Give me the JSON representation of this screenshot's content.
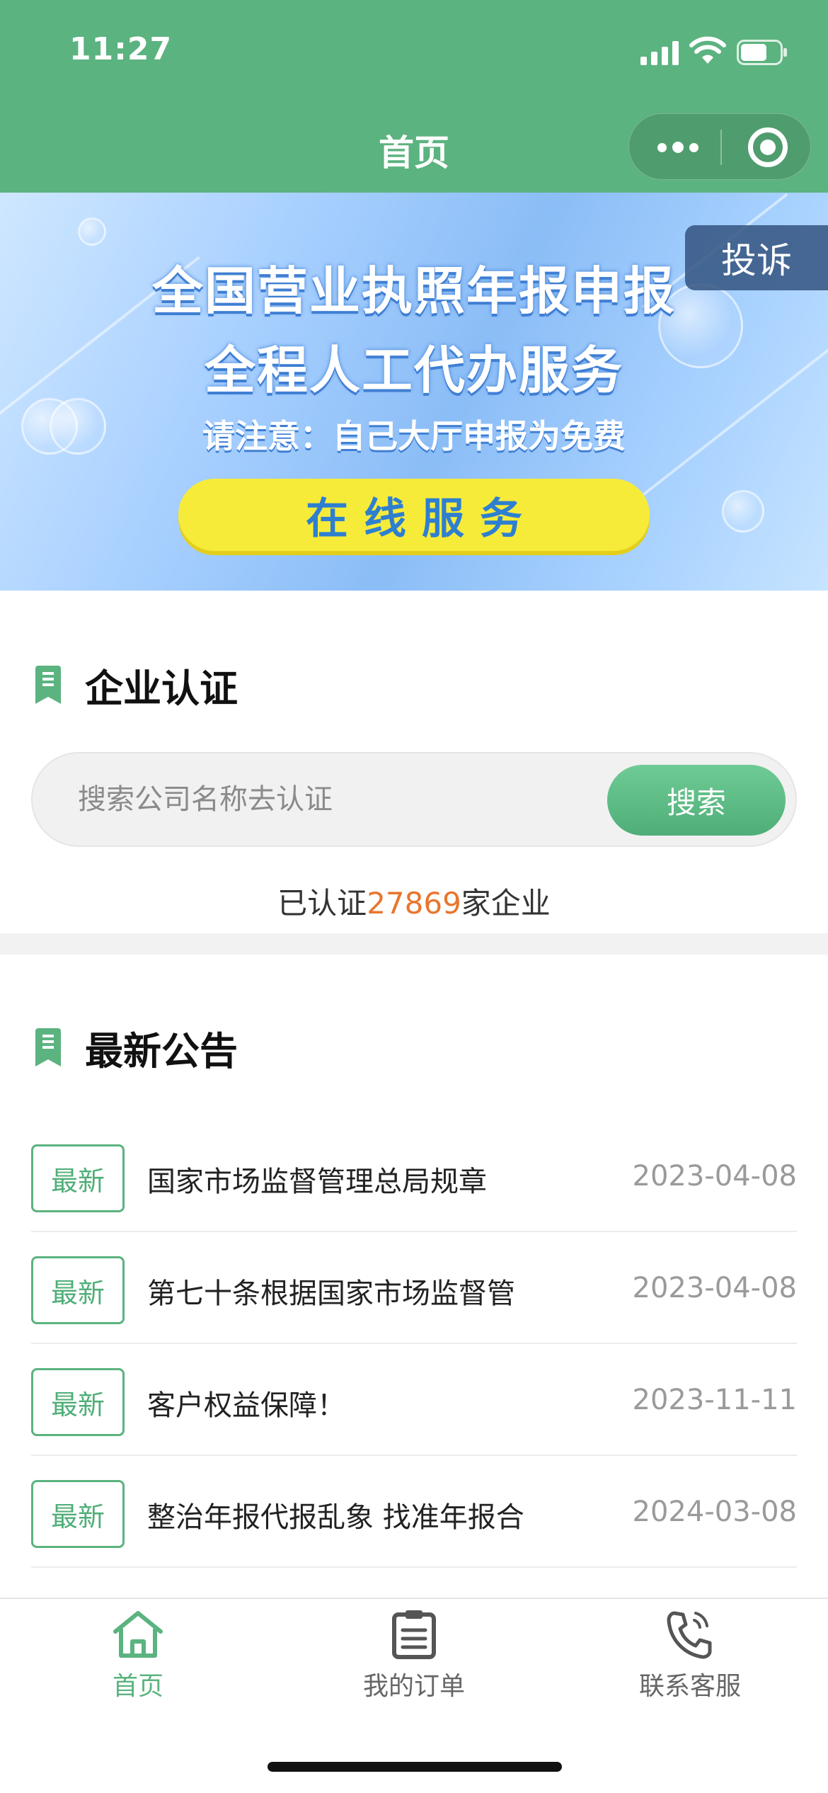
{
  "status_bar": {
    "time": "11:27"
  },
  "nav": {
    "title": "首页"
  },
  "banner": {
    "line1": "全国营业执照年报申报",
    "line2": "全程人工代办服务",
    "line3": "请注意：自己大厅申报为免费",
    "button_label": "在线服务",
    "complaint_label": "投诉"
  },
  "enterprise_section": {
    "title": "企业认证",
    "search_placeholder": "搜索公司名称去认证",
    "search_button": "搜索",
    "verified_prefix": "已认证",
    "verified_count": "27869",
    "verified_suffix": "家企业"
  },
  "news_section": {
    "title": "最新公告",
    "items": [
      {
        "tag": "最新",
        "title": "国家市场监督管理总局规章",
        "date": "2023-04-08"
      },
      {
        "tag": "最新",
        "title": "第七十条根据国家市场监督管",
        "date": "2023-04-08"
      },
      {
        "tag": "最新",
        "title": "客户权益保障！",
        "date": "2023-11-11"
      },
      {
        "tag": "最新",
        "title": "整治年报代报乱象 找准年报合",
        "date": "2024-03-08"
      }
    ]
  },
  "tabbar": {
    "items": [
      {
        "label": "首页",
        "icon": "home-icon",
        "active": true
      },
      {
        "label": "我的订单",
        "icon": "clipboard-icon",
        "active": false
      },
      {
        "label": "联系客服",
        "icon": "phone-icon",
        "active": false
      }
    ]
  },
  "colors": {
    "brand_green": "#5bb37f",
    "accent_orange": "#e8762e",
    "banner_button": "#f7eb3a"
  }
}
